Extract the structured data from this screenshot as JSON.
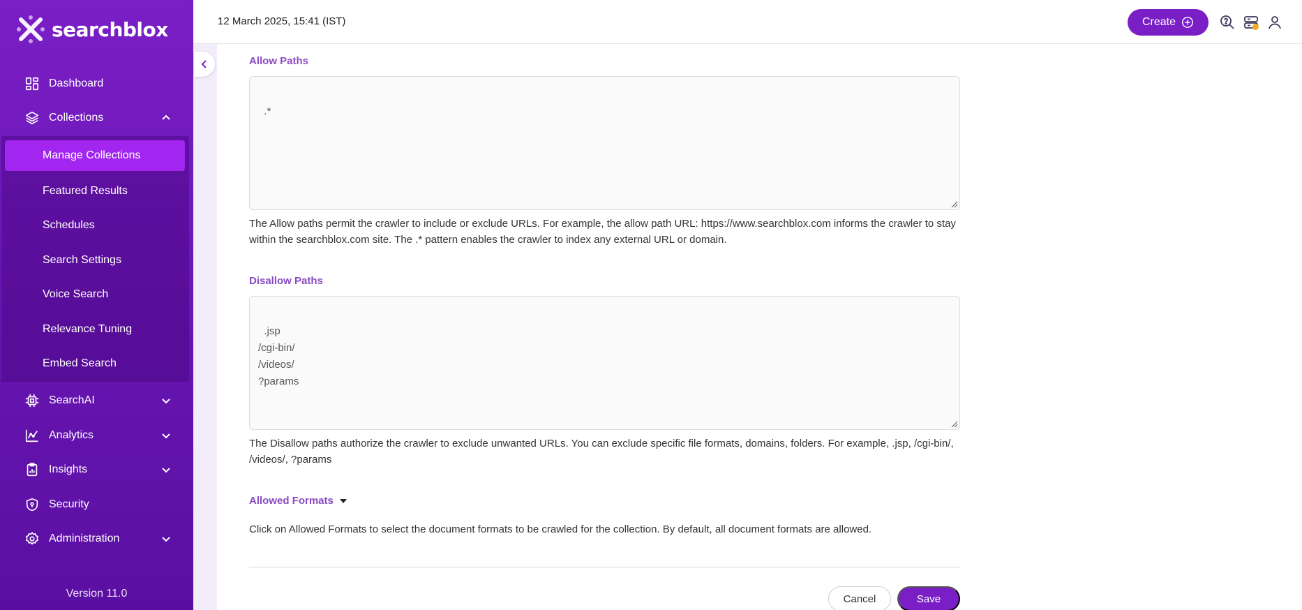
{
  "app": {
    "brand": "searchblox",
    "version": "Version 11.0"
  },
  "header": {
    "datetime": "12 March 2025, 15:41 (IST)",
    "create_label": "Create"
  },
  "sidebar": {
    "items": [
      {
        "label": "Dashboard",
        "icon": "dashboard-icon"
      },
      {
        "label": "Collections",
        "icon": "layers-icon"
      },
      {
        "label": "SearchAI",
        "icon": "chip-icon"
      },
      {
        "label": "Analytics",
        "icon": "analytics-icon"
      },
      {
        "label": "Insights",
        "icon": "clipboard-icon"
      },
      {
        "label": "Security",
        "icon": "shield-icon"
      },
      {
        "label": "Administration",
        "icon": "gear-icon"
      }
    ],
    "collections_sub": [
      {
        "label": "Manage Collections",
        "active": true
      },
      {
        "label": "Featured Results"
      },
      {
        "label": "Schedules"
      },
      {
        "label": "Search Settings"
      },
      {
        "label": "Voice Search"
      },
      {
        "label": "Relevance Tuning"
      },
      {
        "label": "Embed Search"
      }
    ]
  },
  "form": {
    "allow": {
      "label": "Allow Paths",
      "value": ".*",
      "help": "The Allow paths permit the crawler to include or exclude URLs. For example, the allow path URL: https://www.searchblox.com informs the crawler to stay within the searchblox.com site. The .* pattern enables the crawler to index any external URL or domain."
    },
    "disallow": {
      "label": "Disallow Paths",
      "value": ".jsp\n/cgi-bin/\n/videos/\n?params",
      "help": "The Disallow paths authorize the crawler to exclude unwanted URLs. You can exclude specific file formats, domains, folders. For example, .jsp, /cgi-bin/, /videos/, ?params"
    },
    "formats": {
      "label": "Allowed Formats",
      "help": "Click on Allowed Formats to select the document formats to be crawled for the collection. By default, all document formats are allowed."
    },
    "cancel_label": "Cancel",
    "save_label": "Save"
  },
  "colors": {
    "brand": "#7a1fc6",
    "active_nav": "#a226f0",
    "label": "#8a4ac2"
  }
}
